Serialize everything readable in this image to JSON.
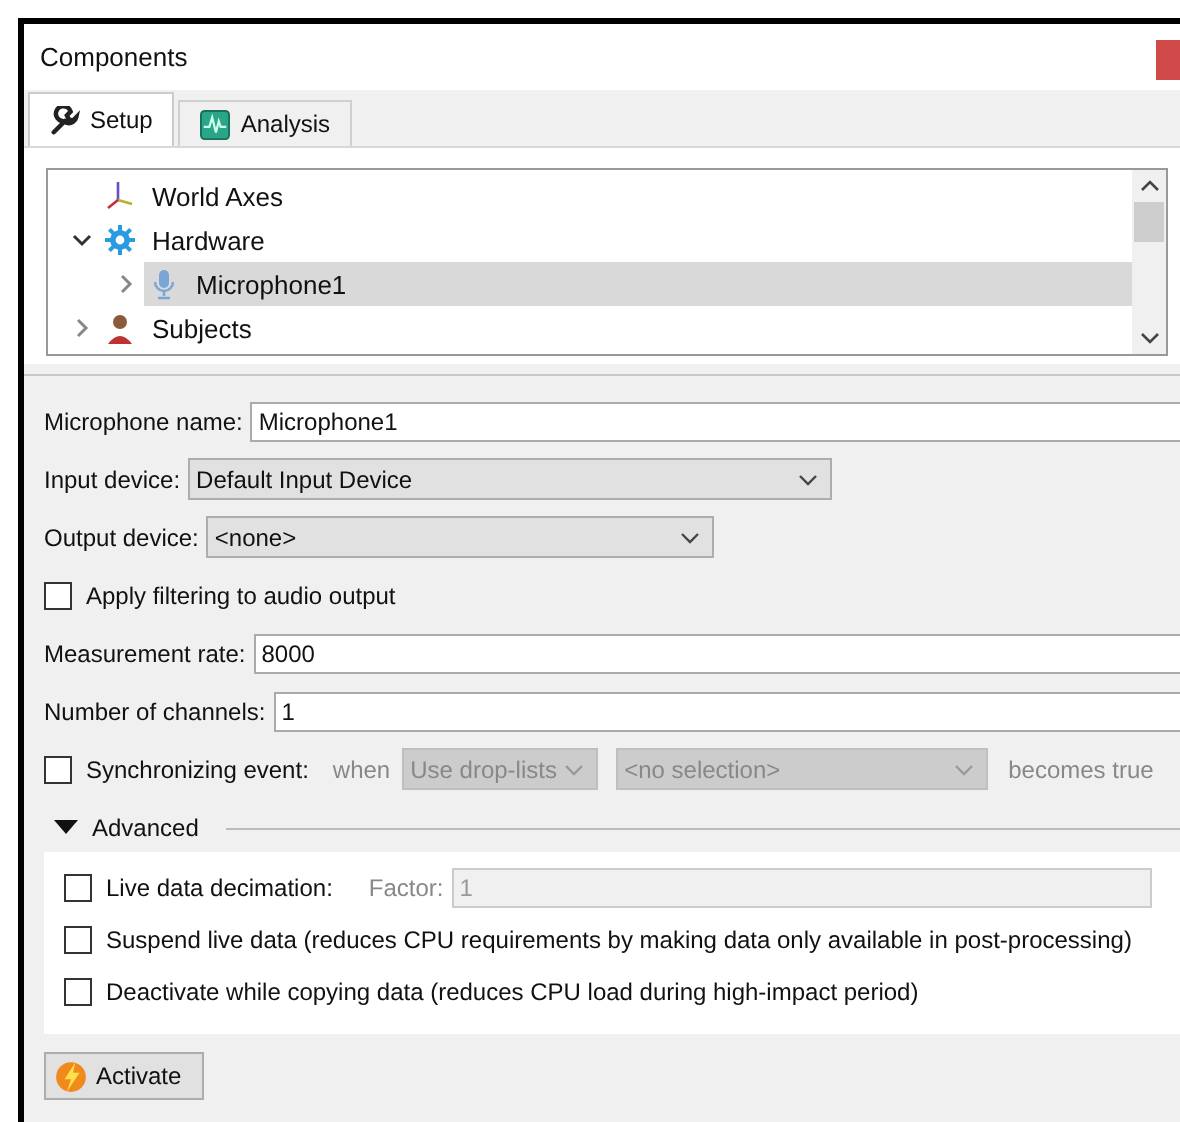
{
  "window": {
    "title": "Components"
  },
  "tabs": [
    {
      "label": "Setup",
      "selected": true
    },
    {
      "label": "Analysis",
      "selected": false
    }
  ],
  "tree": [
    {
      "label": "World Axes",
      "selected": false
    },
    {
      "label": "Hardware",
      "selected": false,
      "expanded": true,
      "children": [
        {
          "label": "Microphone1",
          "selected": true,
          "expanded": false
        }
      ]
    },
    {
      "label": "Subjects",
      "selected": false,
      "expanded": false
    }
  ],
  "form": [
    {
      "kind": "text",
      "label": "Microphone name:",
      "value": "Microphone1"
    },
    {
      "kind": "select",
      "label": "Input device:",
      "value": "Default Input Device"
    },
    {
      "kind": "select",
      "label": "Output device:",
      "value": "<none>"
    },
    {
      "kind": "checkbox",
      "label": "Apply filtering to audio output",
      "checked": false
    },
    {
      "kind": "text",
      "label": "Measurement rate:",
      "value": "8000"
    },
    {
      "kind": "text",
      "label": "Number of channels:",
      "value": "1"
    },
    {
      "kind": "sync",
      "label": "Synchronizing event:",
      "checked": false,
      "when": "when",
      "source": {
        "value": "Use drop-lists",
        "disabled": true
      },
      "selection": {
        "value": "<no selection>",
        "disabled": true
      },
      "suffix": "becomes true"
    }
  ],
  "advanced": {
    "label": "Advanced",
    "expanded": true,
    "options": [
      {
        "label": "Live data decimation:",
        "checked": false,
        "factor": {
          "label": "Factor:",
          "value": "1",
          "disabled": true
        }
      },
      {
        "label": "Suspend live data (reduces CPU requirements by making data only available in post-processing)",
        "checked": false
      },
      {
        "label": "Deactivate while copying data (reduces CPU load during high-impact period)",
        "checked": false
      }
    ]
  },
  "activate_button": {
    "label": "Activate"
  }
}
